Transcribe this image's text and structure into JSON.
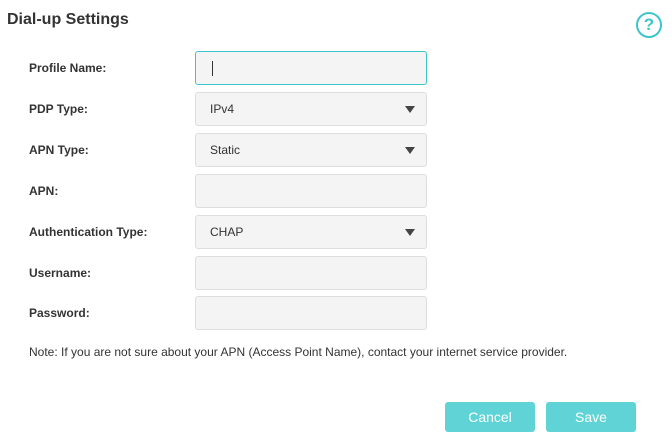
{
  "title": "Dial-up Settings",
  "help_icon": "?",
  "form": {
    "profile_name": {
      "label": "Profile Name:",
      "value": ""
    },
    "pdp_type": {
      "label": "PDP Type:",
      "value": "IPv4"
    },
    "apn_type": {
      "label": "APN Type:",
      "value": "Static"
    },
    "apn": {
      "label": "APN:",
      "value": ""
    },
    "auth_type": {
      "label": "Authentication Type:",
      "value": "CHAP"
    },
    "username": {
      "label": "Username:",
      "value": ""
    },
    "password": {
      "label": "Password:",
      "value": ""
    }
  },
  "note": "Note: If you are not sure about your APN (Access Point Name), contact your internet service provider.",
  "buttons": {
    "cancel": "Cancel",
    "save": "Save"
  },
  "colors": {
    "accent": "#3cc6cc",
    "button": "#5fd3d5",
    "field_bg": "#f4f4f4"
  }
}
